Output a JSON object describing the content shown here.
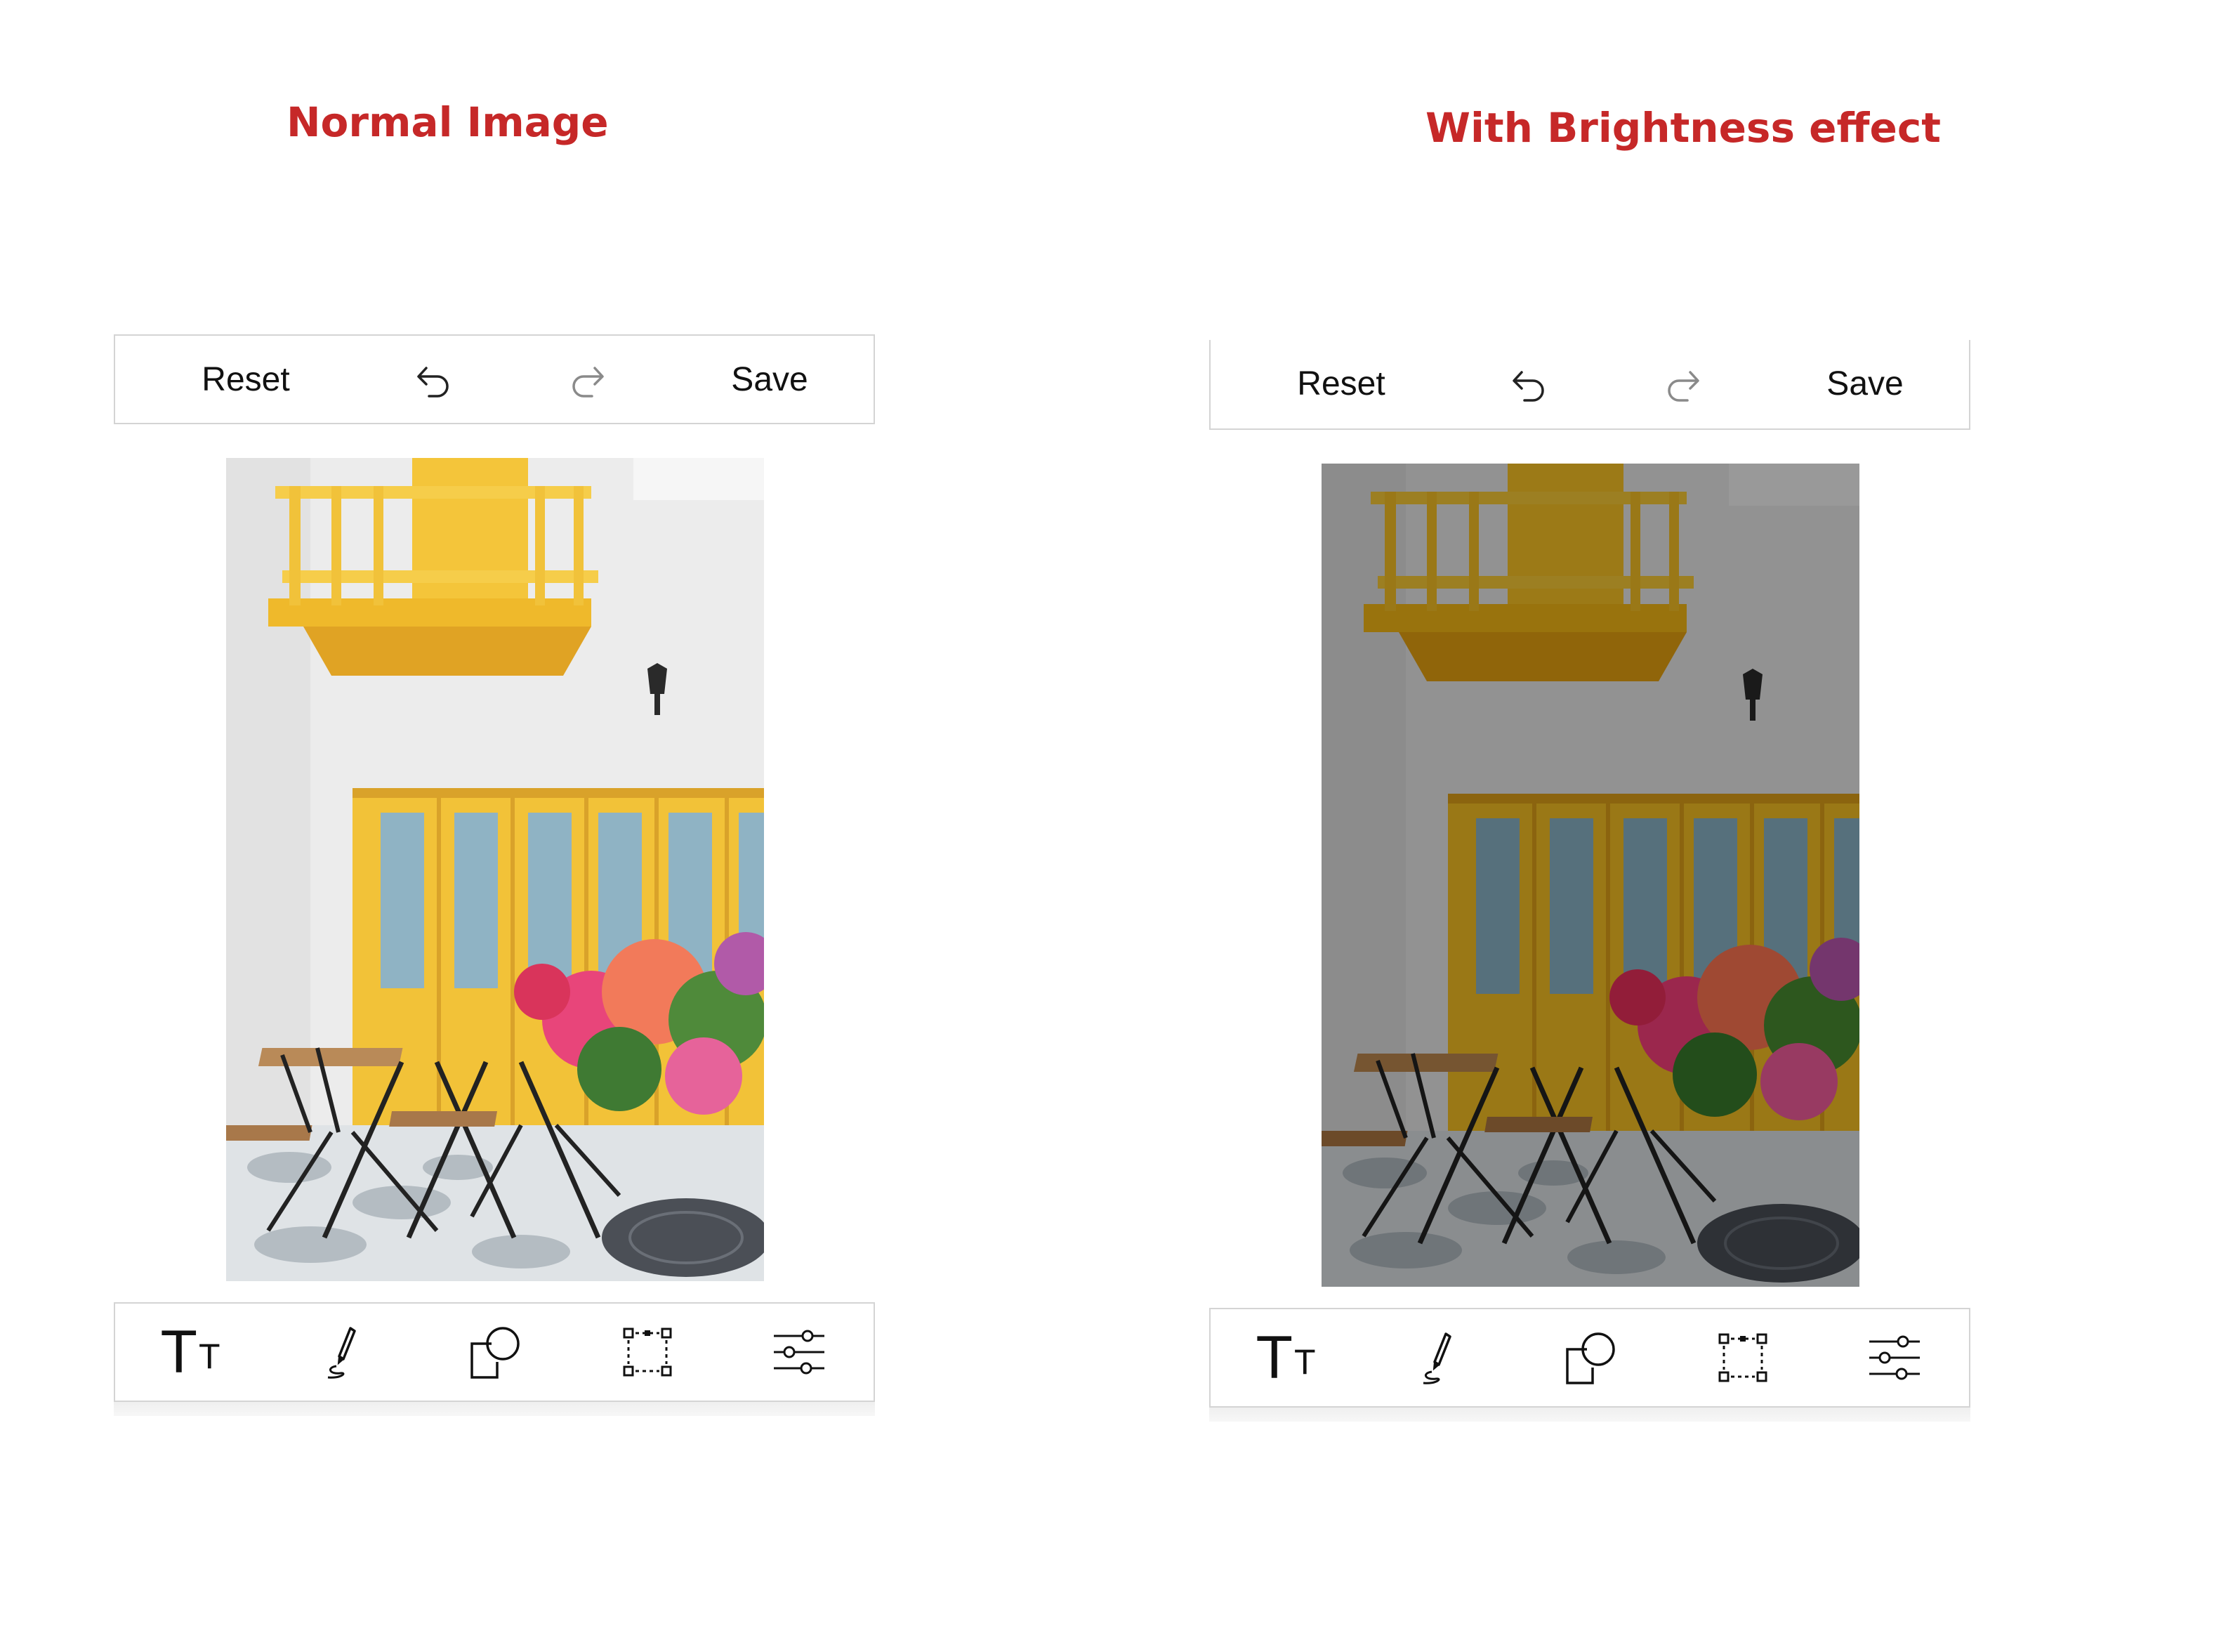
{
  "panels": [
    {
      "caption": "Normal Image",
      "toolbar": {
        "reset_label": "Reset",
        "undo_icon": "undo-icon",
        "redo_icon": "redo-icon",
        "save_label": "Save"
      },
      "image": {
        "effect": "none",
        "brightness": 1.0
      },
      "tools": [
        {
          "name": "text-tool",
          "icon": "text-size-icon",
          "glyph_big": "T",
          "glyph_small": "T"
        },
        {
          "name": "pen-tool",
          "icon": "pen-icon"
        },
        {
          "name": "shape-tool",
          "icon": "shapes-icon"
        },
        {
          "name": "crop-tool",
          "icon": "crop-selection-icon"
        },
        {
          "name": "filter-tool",
          "icon": "sliders-icon"
        }
      ]
    },
    {
      "caption": "With Brightness effect",
      "toolbar": {
        "reset_label": "Reset",
        "undo_icon": "undo-icon",
        "redo_icon": "redo-icon",
        "save_label": "Save"
      },
      "image": {
        "effect": "brightness",
        "brightness": 0.62
      },
      "tools": [
        {
          "name": "text-tool",
          "icon": "text-size-icon",
          "glyph_big": "T",
          "glyph_small": "T"
        },
        {
          "name": "pen-tool",
          "icon": "pen-icon"
        },
        {
          "name": "shape-tool",
          "icon": "shapes-icon"
        },
        {
          "name": "crop-tool",
          "icon": "crop-selection-icon"
        },
        {
          "name": "filter-tool",
          "icon": "sliders-icon"
        }
      ]
    }
  ],
  "colors": {
    "caption": "#c62828",
    "door_yellow": "#f2c33a",
    "wall": "#ececec"
  }
}
